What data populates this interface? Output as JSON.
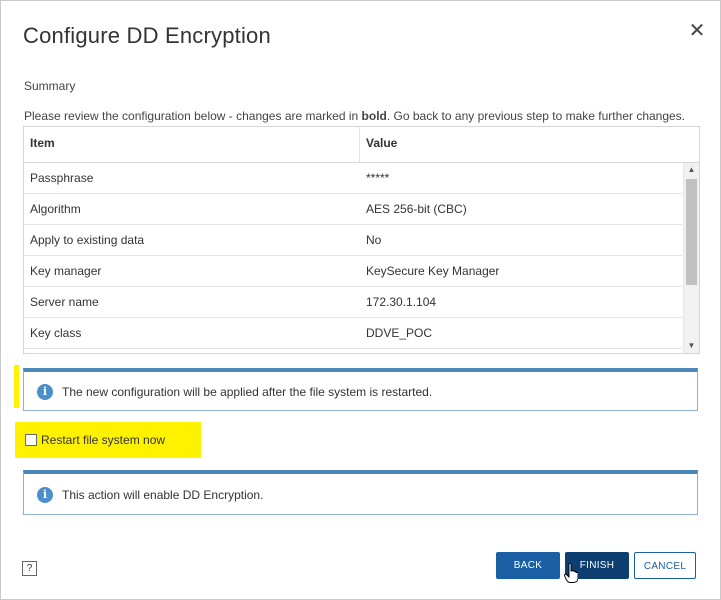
{
  "dialog": {
    "title": "Configure DD Encryption",
    "close_icon": "close-icon",
    "close_glyph": "✕",
    "step_name": "Summary",
    "instructions_before": "Please review the configuration below - changes are marked in ",
    "instructions_bold": "bold",
    "instructions_after": ". Go back to any previous step to make further changes."
  },
  "grid": {
    "columns": [
      "Item",
      "Value"
    ],
    "rows": [
      {
        "item": "Passphrase",
        "value": "*****"
      },
      {
        "item": "Algorithm",
        "value": "AES 256-bit (CBC)"
      },
      {
        "item": "Apply to existing data",
        "value": "No"
      },
      {
        "item": "Key manager",
        "value": "KeySecure Key Manager"
      },
      {
        "item": "Server name",
        "value": "172.30.1.104"
      },
      {
        "item": "Key class",
        "value": "DDVE_POC"
      }
    ],
    "scroll_up_glyph": "▲",
    "scroll_down_glyph": "▼"
  },
  "info_restart": {
    "icon": "info-icon",
    "glyph": "i",
    "message": "The new configuration will be applied after the file system is restarted."
  },
  "restart_option": {
    "label": "Restart file system now",
    "checked": false
  },
  "info_enable": {
    "icon": "info-icon",
    "glyph": "i",
    "message": "This action will enable DD Encryption."
  },
  "footer": {
    "help_glyph": "?",
    "back_label": "BACK",
    "finish_label": "FINISH",
    "cancel_label": "CANCEL"
  },
  "colors": {
    "accent": "#1a5fa3",
    "finish": "#0d3e70",
    "info_border": "#4a87bb",
    "highlight": "#fff200"
  }
}
